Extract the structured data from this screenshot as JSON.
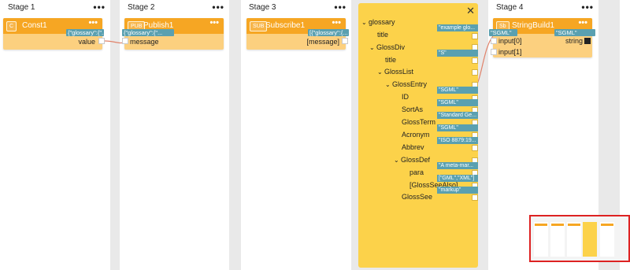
{
  "stages": [
    {
      "title": "Stage 1",
      "menu": "•••"
    },
    {
      "title": "Stage 2",
      "menu": "•••"
    },
    {
      "title": "Stage 3",
      "menu": "•••"
    },
    {
      "title": "Stage 4",
      "menu": "•••"
    }
  ],
  "nodes": {
    "const1": {
      "type": "C",
      "name": "Const1",
      "menu": "•••",
      "value_chip": "{\"glossary\":{\"...",
      "port_label": "value"
    },
    "publish1": {
      "type": "PUB",
      "name": "Publish1",
      "menu": "•••",
      "input_chip": "{\"glossary\":{\"...",
      "port_label": "message"
    },
    "subscribe1": {
      "type": "SUB",
      "name": "Subscribe1",
      "menu": "•••",
      "output_chip": "[{\"glossary\":{...",
      "port_label": "[message]"
    },
    "stringbuild1": {
      "type": "Sb",
      "name": "StringBuild1",
      "menu": "•••",
      "input0_chip": "\"SGML\"",
      "output_chip": "\"SGML\"",
      "input0_label": "input[0]",
      "input1_label": "input[1]",
      "output_label": "string"
    }
  },
  "inspector": {
    "close": "✕",
    "rows": [
      {
        "label": "glossary",
        "caret": "⌄",
        "value": ""
      },
      {
        "label": "title",
        "caret": "",
        "value": "\"example glo..."
      },
      {
        "label": "GlossDiv",
        "caret": "⌄",
        "value": ""
      },
      {
        "label": "title",
        "caret": "",
        "value": "\"S\""
      },
      {
        "label": "GlossList",
        "caret": "⌄",
        "value": ""
      },
      {
        "label": "GlossEntry",
        "caret": "⌄",
        "value": ""
      },
      {
        "label": "ID",
        "caret": "",
        "value": "\"SGML\""
      },
      {
        "label": "SortAs",
        "caret": "",
        "value": "\"SGML\""
      },
      {
        "label": "GlossTerm",
        "caret": "",
        "value": "\"Standard Ge..."
      },
      {
        "label": "Acronym",
        "caret": "",
        "value": "\"SGML\""
      },
      {
        "label": "Abbrev",
        "caret": "",
        "value": "\"ISO 8879:19..."
      },
      {
        "label": "GlossDef",
        "caret": "⌄",
        "value": ""
      },
      {
        "label": "para",
        "caret": "",
        "value": "\"A meta-mar..."
      },
      {
        "label": "[GlossSeeAlso]",
        "caret": "",
        "value": "[\"GML\",\"XML\"]"
      },
      {
        "label": "GlossSee",
        "caret": "",
        "value": "\"markup\""
      }
    ]
  },
  "colors": {
    "node_header": "#f6a623",
    "node_body": "#fcd07f",
    "chip": "#5aa0b0",
    "inspector": "#fcd24a",
    "wire": "#e0826a",
    "minimap_border": "#d22"
  }
}
